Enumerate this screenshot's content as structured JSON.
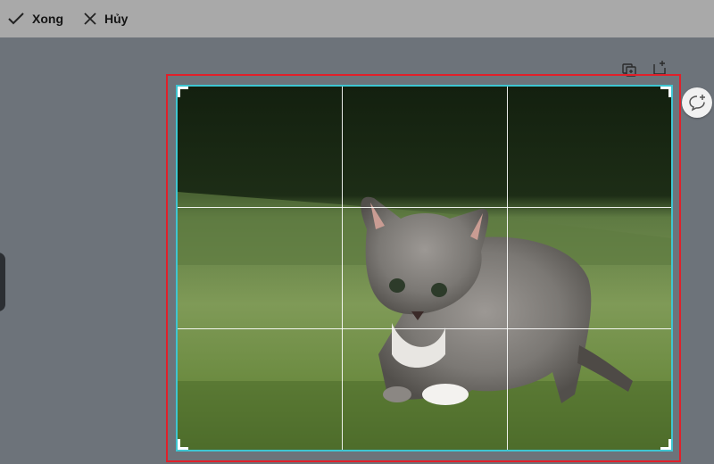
{
  "toolbar": {
    "done_label": "Xong",
    "cancel_label": "Hủy",
    "done_icon": "check-icon",
    "cancel_icon": "close-icon"
  },
  "page_icons": [
    "duplicate-page-icon",
    "add-page-icon",
    "add-comment-icon"
  ],
  "crop": {
    "image": "kitten-on-grass",
    "grid": "rule-of-thirds"
  },
  "colors": {
    "toolbar_bg": "#a9a9a9",
    "canvas_bg": "#6d737a",
    "selection_border": "#e0202a",
    "crop_border": "#3ec6d2"
  }
}
